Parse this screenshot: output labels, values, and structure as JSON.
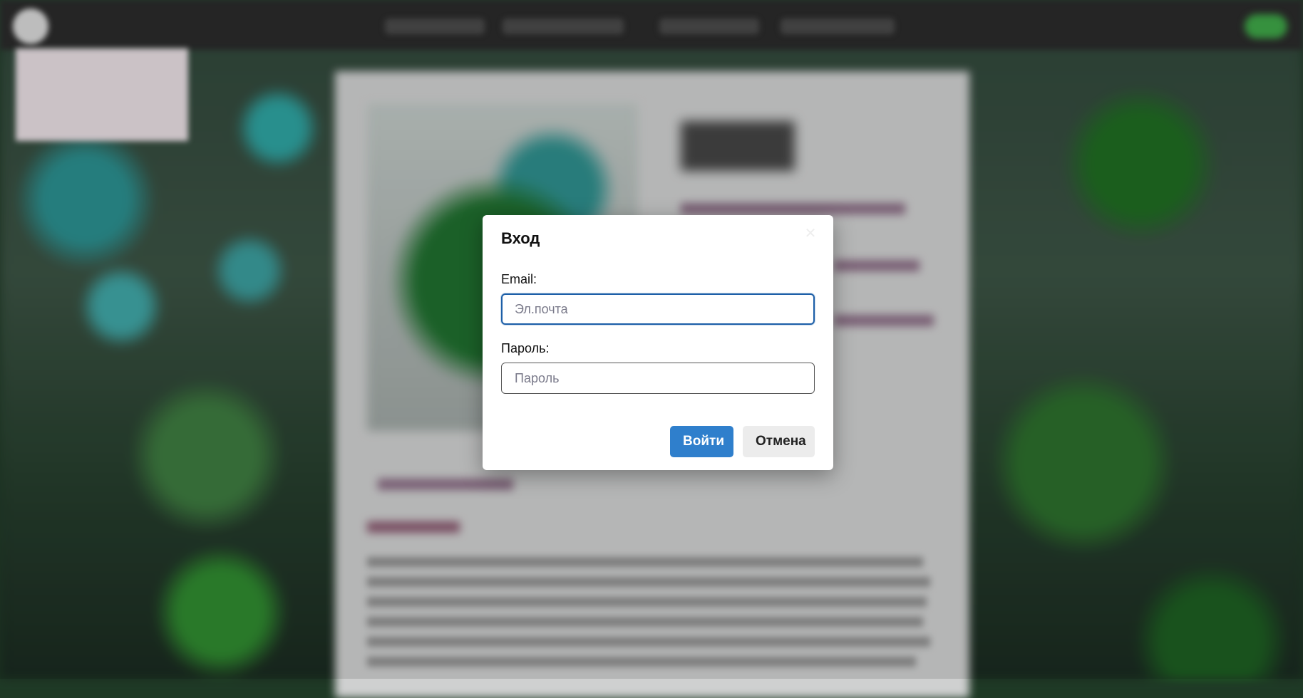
{
  "modal": {
    "title": "Вход",
    "close_icon": "close-icon",
    "email": {
      "label": "Email:",
      "placeholder": "Эл.почта",
      "value": ""
    },
    "password": {
      "label": "Пароль:",
      "placeholder": "Пароль",
      "value": ""
    },
    "submit_label": "Войти",
    "cancel_label": "Отмена"
  },
  "colors": {
    "primary": "#2f7fcc",
    "focus_border": "#1d5fa8",
    "secondary_button": "#ececec",
    "topbar": "#2b2b2b"
  }
}
